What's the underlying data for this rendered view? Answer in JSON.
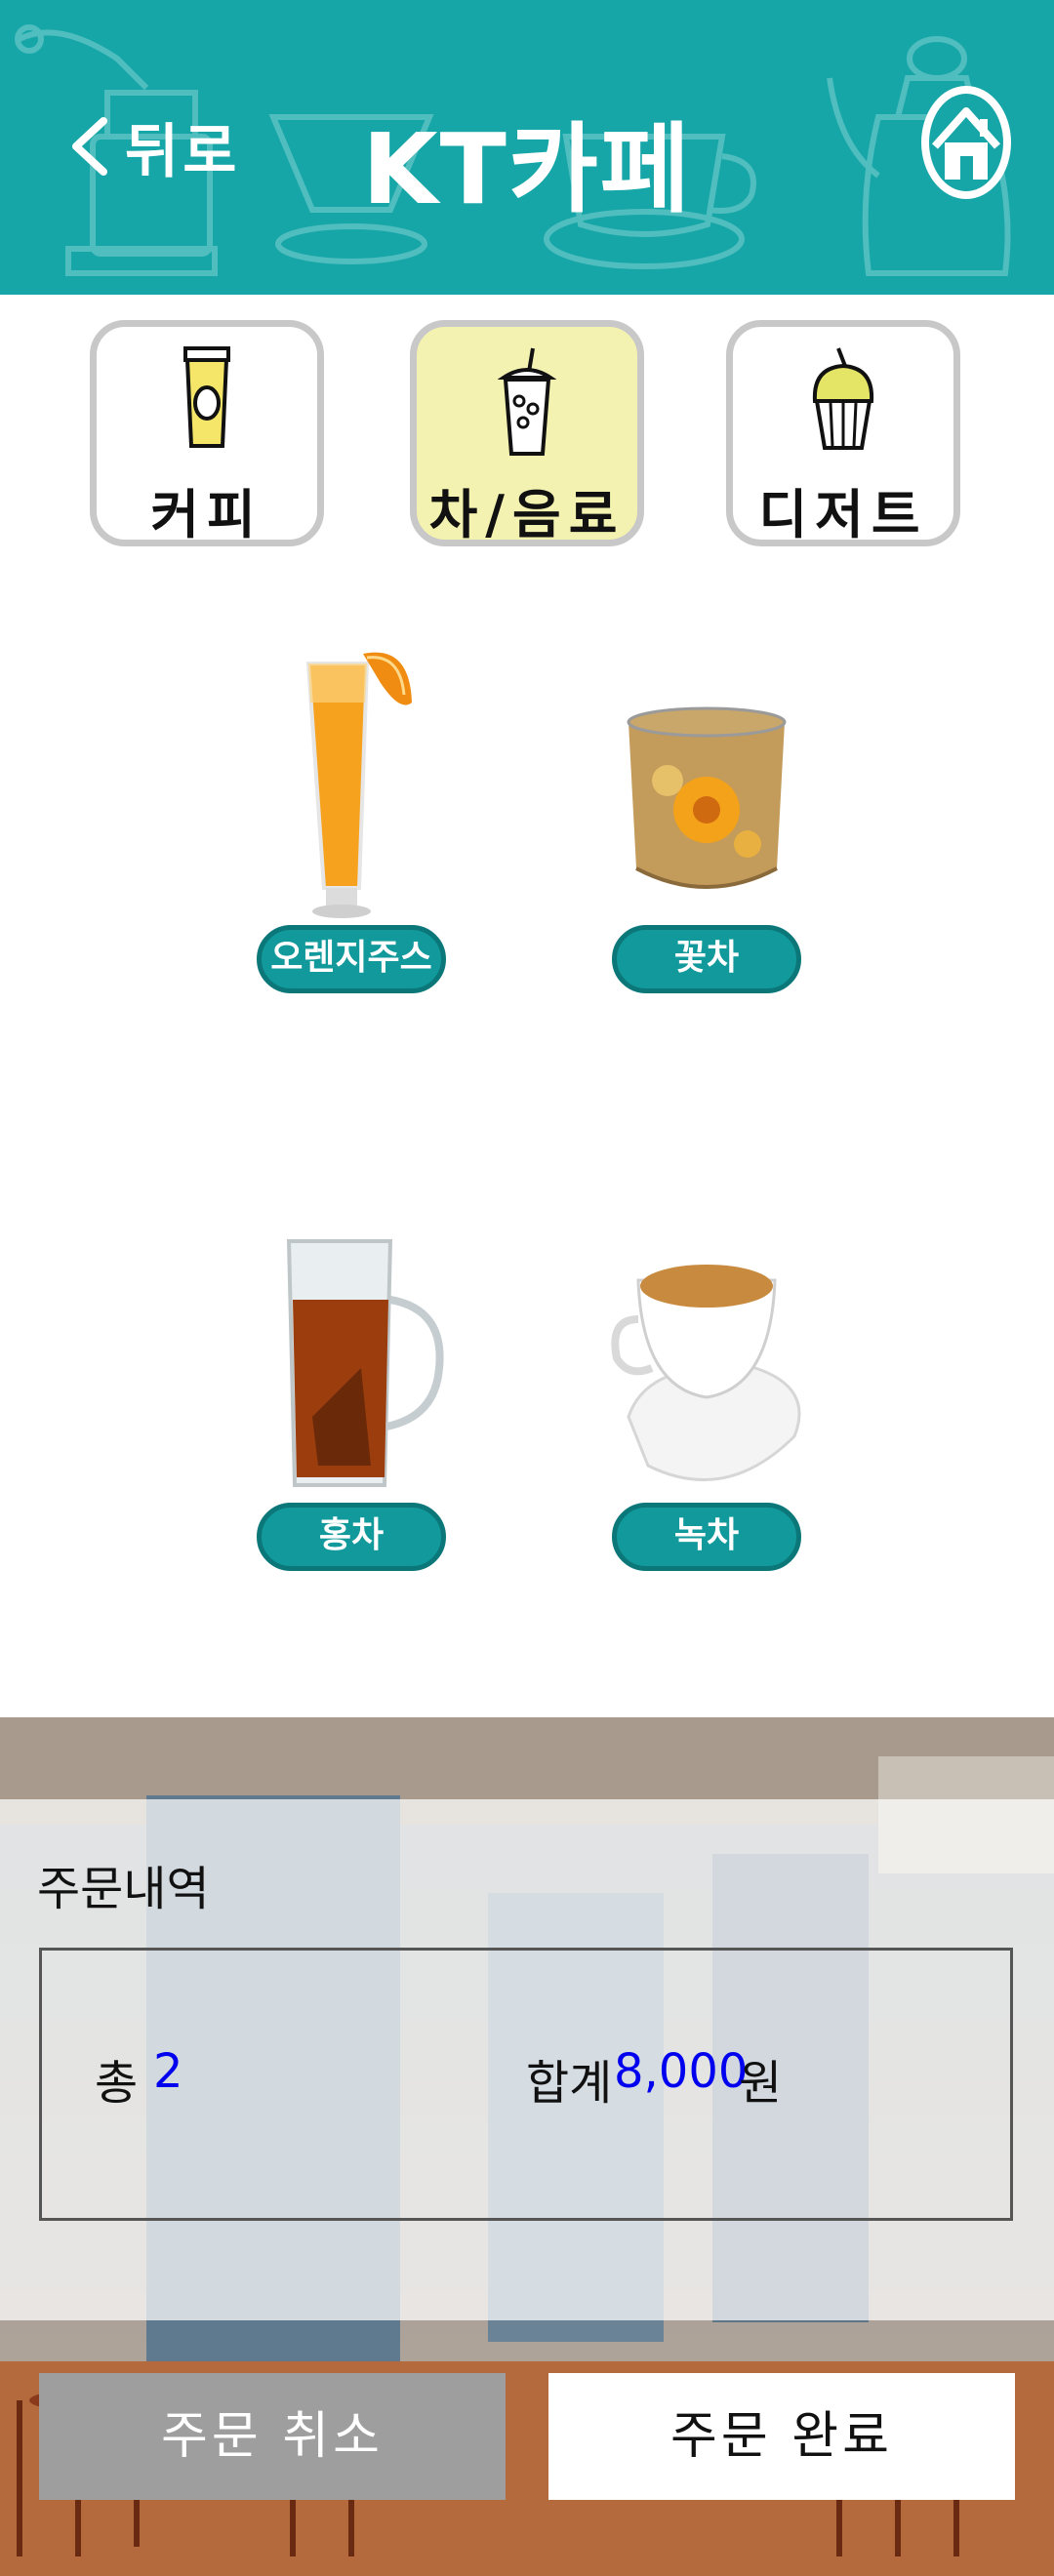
{
  "header": {
    "back_label": "뒤로",
    "title": "KT카페",
    "home_icon": "home-icon",
    "color": "#17a6a8"
  },
  "categories": [
    {
      "label": "커피",
      "icon": "coffee-cup-icon",
      "active": false
    },
    {
      "label": "차/음료",
      "icon": "drink-cup-icon",
      "active": true
    },
    {
      "label": "디저트",
      "icon": "muffin-icon",
      "active": false
    }
  ],
  "menu_items": [
    {
      "label": "오렌지주스",
      "image": "orange-juice-image"
    },
    {
      "label": "꽃차",
      "image": "flower-tea-image"
    },
    {
      "label": "홍차",
      "image": "black-tea-image"
    },
    {
      "label": "녹차",
      "image": "green-tea-image"
    }
  ],
  "order": {
    "label": "주문내역",
    "total_count_label": "총",
    "total_count": "2",
    "total_price_label": "합계",
    "total_price": "8,000",
    "currency": "원"
  },
  "actions": {
    "cancel_label": "주문 취소",
    "complete_label": "주문 완료"
  },
  "colors": {
    "accent": "#17a6a8",
    "active_tab": "#f3f2b0",
    "value_text": "#0000ee",
    "cancel_button": "#9e9e9e"
  }
}
